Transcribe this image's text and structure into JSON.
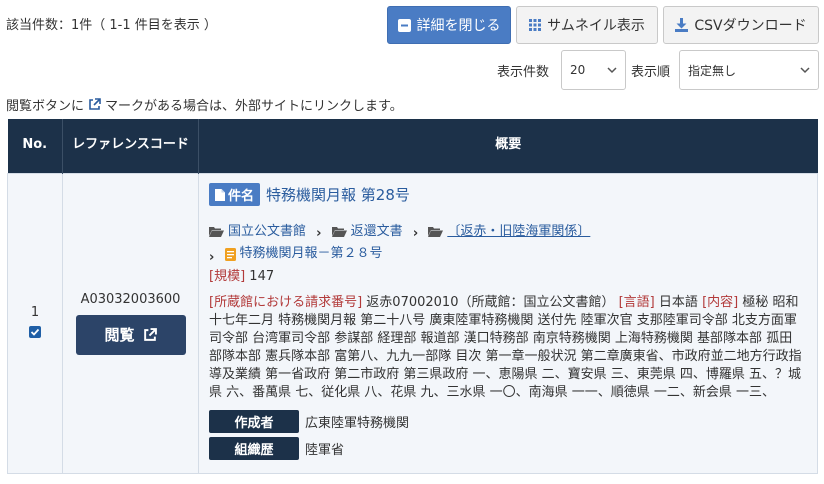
{
  "results": {
    "count_text": "該当件数：1件（ 1-1 件目を表示 ）"
  },
  "toolbar": {
    "close_detail_label": "詳細を閉じる",
    "thumbnail_label": "サムネイル表示",
    "csv_label": "CSVダウンロード",
    "per_page_label": "表示件数",
    "per_page_value": "20",
    "order_label": "表示順",
    "order_value": "指定無し"
  },
  "notice": {
    "before": "閲覧ボタンに",
    "after": "マークがある場合は、外部サイトにリンクします。"
  },
  "table": {
    "headers": {
      "no": "No.",
      "ref": "レファレンスコード",
      "summary": "概要"
    },
    "row": {
      "no": "1",
      "checked": true,
      "ref_code": "A03032003600",
      "view_label": "閲覧",
      "tag_label": "件名",
      "title": "特務機関月報 第28号",
      "crumbs": [
        "国立公文書館",
        "返還文書",
        "〔返赤・旧陸海軍関係〕",
        "特務機関月報－第２８号"
      ],
      "scale_label": "[規模]",
      "scale_value": "147",
      "request_label": "[所蔵館における請求番号]",
      "request_value": "返赤07002010（所蔵館：国立公文書館）",
      "lang_label": "[言語]",
      "lang_value": "日本語",
      "content_label": "[内容]",
      "content_value": "極秘 昭和十七年二月 特務機関月報 第二十八号 廣東陸軍特務機関 送付先 陸軍次官 支那陸軍司令部 北支方面軍司令部 台湾軍司令部 参謀部 経理部 報道部 漢口特務部 南京特務機関 上海特務機関 基部隊本部 孤田部隊本部 憲兵隊本部 富第八、九九一部隊 目次 第一章一般状況 第二章廣東省、市政府並二地方行政指導及業績 第一省政府 第二市政府 第三県政府 一、恵陽県 二、寶安県 三、東莞県 四、博羅県 五、？城県 六、番萬県 七、従化県 八、花県 九、三水県 一〇、南海県 一一、順徳県 一二、新会県 一三、",
      "creator_label": "作成者",
      "creator_value": "広東陸軍特務機関",
      "org_label": "組織歴",
      "org_value": "陸軍省"
    }
  },
  "colors": {
    "header_bg": "#1c3149",
    "accent_blue": "#4a7cc4",
    "link": "#2a5c9e",
    "label_red": "#b23a3a",
    "folder": "#555555",
    "document": "#f0a020"
  },
  "icons": {
    "close_detail": "minus-square-icon",
    "thumbnail": "grid-icon",
    "csv": "download-icon",
    "external": "external-link-icon",
    "folder": "folder-open-icon",
    "document": "document-icon"
  }
}
